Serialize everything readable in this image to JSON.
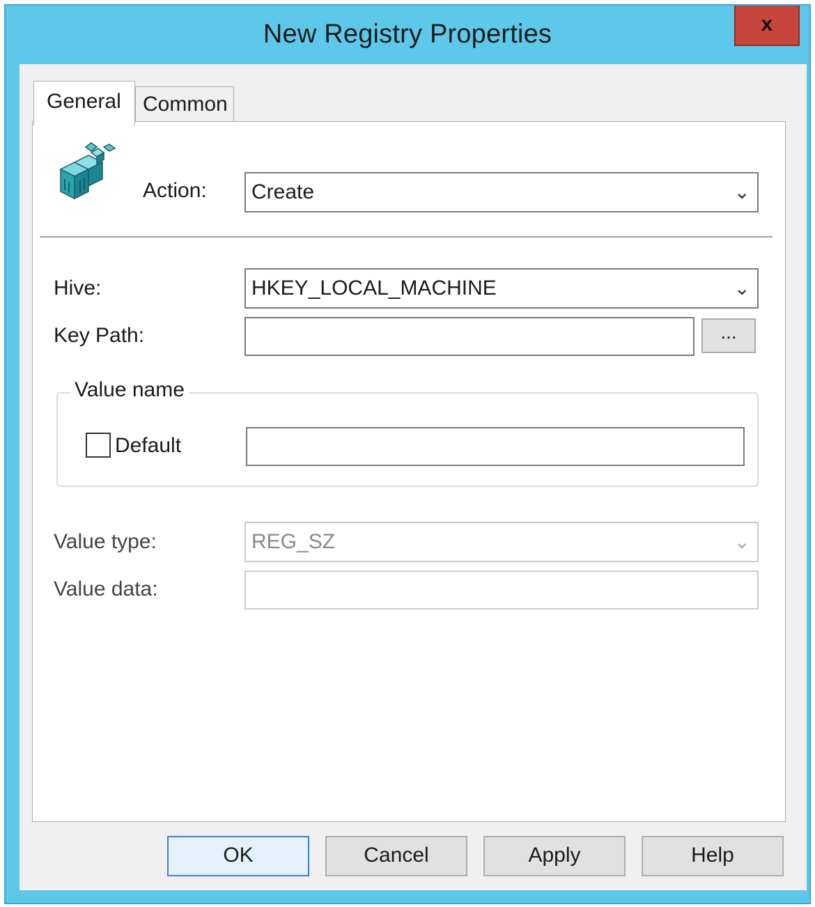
{
  "window": {
    "title": "New Registry Properties",
    "close_glyph": "x"
  },
  "tabs": [
    {
      "label": "General",
      "selected": true
    },
    {
      "label": "Common",
      "selected": false
    }
  ],
  "general": {
    "icon": "registry-cubes-icon",
    "action_label": "Action:",
    "action_value": "Create",
    "hive_label": "Hive:",
    "hive_value": "HKEY_LOCAL_MACHINE",
    "key_path_label": "Key Path:",
    "key_path_value": "",
    "browse_label": "...",
    "value_name_group": "Value name",
    "default_label": "Default",
    "default_checked": false,
    "value_name_value": "",
    "value_type_label": "Value type:",
    "value_type_value": "REG_SZ",
    "value_data_label": "Value data:",
    "value_data_value": ""
  },
  "buttons": {
    "ok": "OK",
    "cancel": "Cancel",
    "apply": "Apply",
    "help": "Help"
  },
  "colors": {
    "titlebar": "#5ec8ea",
    "close": "#c7453a",
    "default_button_border": "#3c7fd1"
  }
}
